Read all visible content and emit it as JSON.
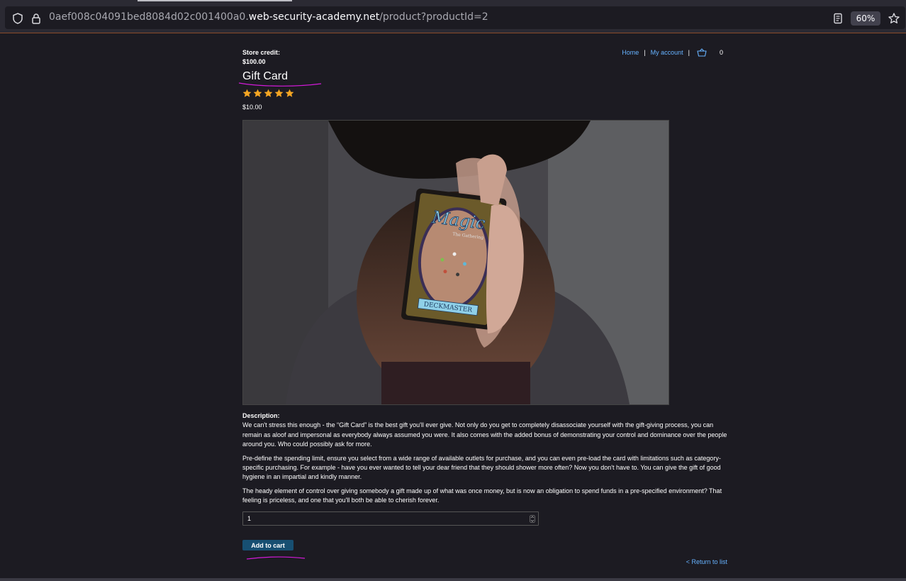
{
  "browser": {
    "url_prefix": "0aef008c04091bed8084d02c001400a0.",
    "url_domain": "web-security-academy.net",
    "url_path": "/product?productId=2",
    "zoom": "60%"
  },
  "header": {
    "store_credit_label": "Store credit:",
    "store_credit_value": "$100.00",
    "nav": {
      "home": "Home",
      "separator": "|",
      "my_account": "My account",
      "cart_count": "0"
    }
  },
  "product": {
    "title": "Gift Card",
    "rating": 5,
    "price": "$10.00",
    "image_card_text": "Magic",
    "image_card_sub": "The Gathering",
    "image_card_footer": "DECKMASTER",
    "description_label": "Description:",
    "description": [
      "We can't stress this enough - the “Gift Card” is the best gift you'll ever give. Not only do you get to completely disassociate yourself with the gift-giving process, you can remain as aloof and impersonal as everybody always assumed you were. It also comes with the added bonus of demonstrating your control and dominance over the people around you. Who could possibly ask for more.",
      "Pre-define the spending limit, ensure you select from a wide range of available outlets for purchase, and you can even pre-load the card with limitations such as category-specific purchasing. For example - have you ever wanted to tell your dear friend that they should shower more often? Now you don't have to. You can give the gift of good hygiene in an impartial and kindly manner.",
      "The heady element of control over giving somebody a gift made up of what was once money, but is now an obligation to spend funds in a pre-specified environment? That feeling is priceless, and one that you'll both be able to cherish forever."
    ]
  },
  "cart_form": {
    "quantity": "1",
    "add_button": "Add to cart"
  },
  "return_link": "< Return to list",
  "colors": {
    "background": "#1c1b22",
    "link": "#66b2ff",
    "star": "#f5a623",
    "button": "#174f72",
    "annotation": "#d21ad8"
  }
}
